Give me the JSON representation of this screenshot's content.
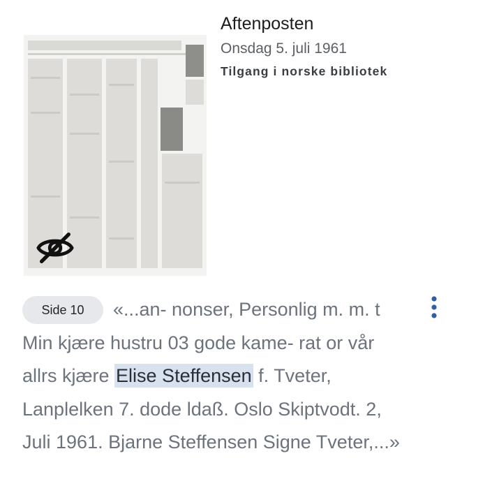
{
  "newspaper": {
    "title": "Aftenposten",
    "date": "Onsdag 5. juli 1961",
    "access": "Tilgang i norske bibliotek"
  },
  "thumbnail": {
    "icon": "eye-off-icon"
  },
  "result": {
    "page_label": "Side 10",
    "snippet_before": "«...an- nonser, Personlig m. m. t Min kjære hustru 03 gode kame- rat or vår allrs kjære ",
    "highlight": "Elise Steffensen",
    "snippet_after": " f. Tveter, Lanplelken 7. dode ldaß. Oslo Skiptvodt. 2, Juli 1961. Bjarne Steffensen Signe Tveter,...»",
    "more_icon": "more-vertical-icon"
  },
  "colors": {
    "highlight_bg": "#d8e2ef",
    "badge_bg": "#e6e8ec",
    "accent": "#2f5fa7"
  }
}
